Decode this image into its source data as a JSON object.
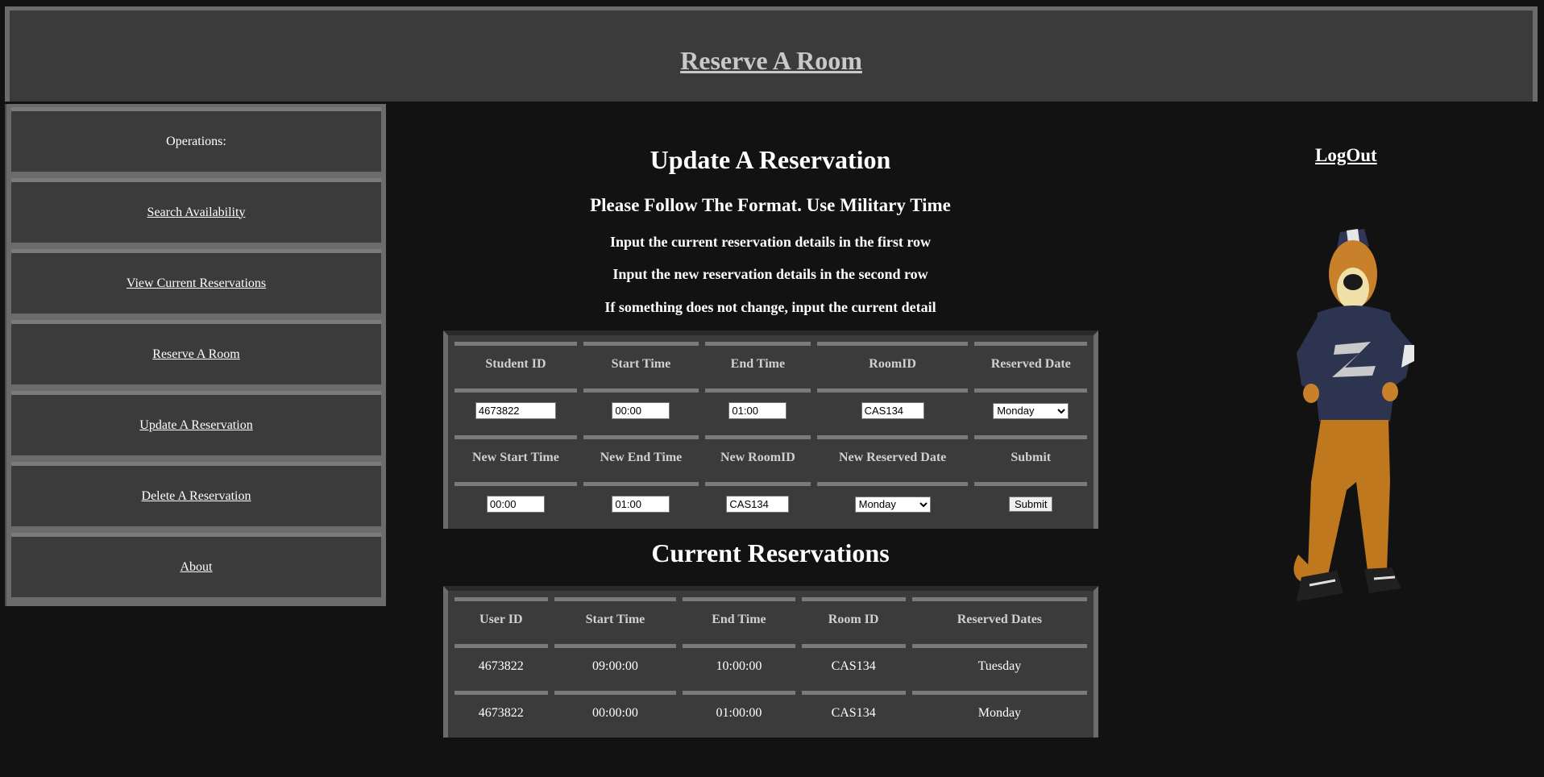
{
  "header": {
    "title": "Reserve A Room"
  },
  "sidebar": {
    "heading": "Operations:",
    "items": [
      {
        "label": "Search Availability"
      },
      {
        "label": "View Current Reservations"
      },
      {
        "label": "Reserve A Room"
      },
      {
        "label": "Update A Reservation"
      },
      {
        "label": "Delete A Reservation"
      },
      {
        "label": "About"
      }
    ]
  },
  "main": {
    "title": "Update A Reservation",
    "format_note": "Please Follow The Format. Use Military Time",
    "instructions": [
      "Input the current reservation details in the first row",
      "Input the new reservation details in the second row",
      "If something does not change, input the current detail"
    ]
  },
  "update_form": {
    "headers_row1": [
      "Student ID",
      "Start Time",
      "End Time",
      "RoomID",
      "Reserved Date"
    ],
    "headers_row2": [
      "New Start Time",
      "New End Time",
      "New RoomID",
      "New Reserved Date",
      "Submit"
    ],
    "student_id": "4673822",
    "start_time": "00:00",
    "end_time": "01:00",
    "room_id": "CAS134",
    "reserved_date": "Monday",
    "new_start_time": "00:00",
    "new_end_time": "01:00",
    "new_room_id": "CAS134",
    "new_reserved_date": "Monday",
    "submit_label": "Submit"
  },
  "current_reservations": {
    "title": "Current Reservations",
    "headers": [
      "User ID",
      "Start Time",
      "End Time",
      "Room ID",
      "Reserved Dates"
    ],
    "rows": [
      [
        "4673822",
        "09:00:00",
        "10:00:00",
        "CAS134",
        "Tuesday"
      ],
      [
        "4673822",
        "00:00:00",
        "01:00:00",
        "CAS134",
        "Monday"
      ]
    ]
  },
  "logout_label": "LogOut",
  "mascot": {
    "icon": "mascot-image"
  }
}
